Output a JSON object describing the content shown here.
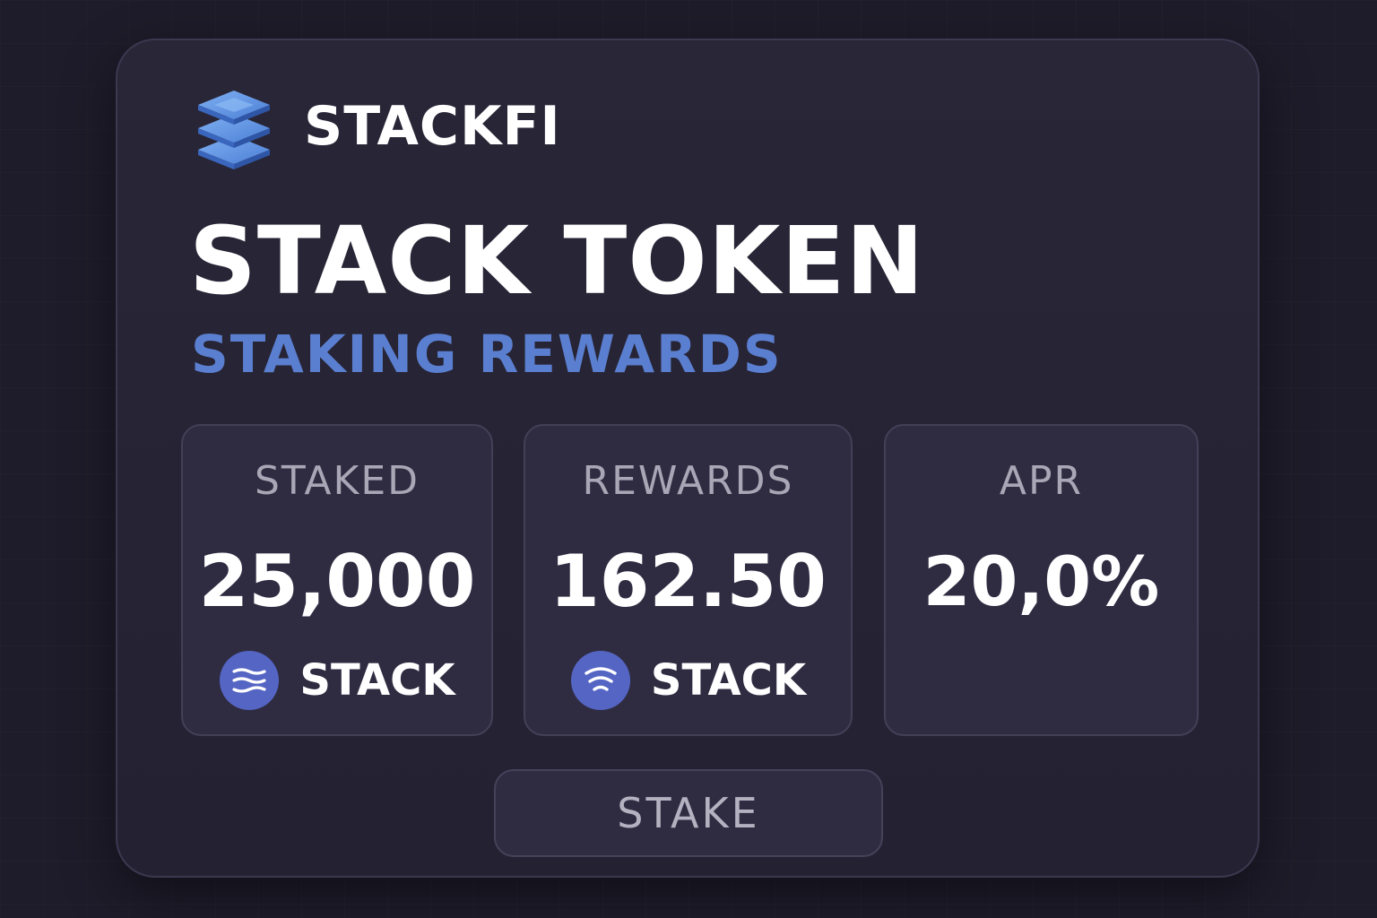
{
  "brand": {
    "name": "STACKFI",
    "logo_icon": "layer-stack-icon"
  },
  "header": {
    "title": "STACK TOKEN",
    "subtitle": "STAKING REWARDS"
  },
  "stats": {
    "staked": {
      "label": "STAKED",
      "value": "25,000",
      "token": "STACK",
      "token_icon": "stack-token-icon"
    },
    "rewards": {
      "label": "REWARDS",
      "value": "162.50",
      "token": "STACK",
      "token_icon": "stack-token-signal-icon"
    },
    "apr": {
      "label": "APR",
      "value": "20,0%"
    }
  },
  "actions": {
    "stake_label": "STAKE"
  },
  "colors": {
    "background": "#1e1c2a",
    "card": "#272435",
    "accent": "#5b7fd0",
    "text": "#ffffff",
    "muted": "#a9a7b6",
    "token_icon": "#5565c4"
  }
}
